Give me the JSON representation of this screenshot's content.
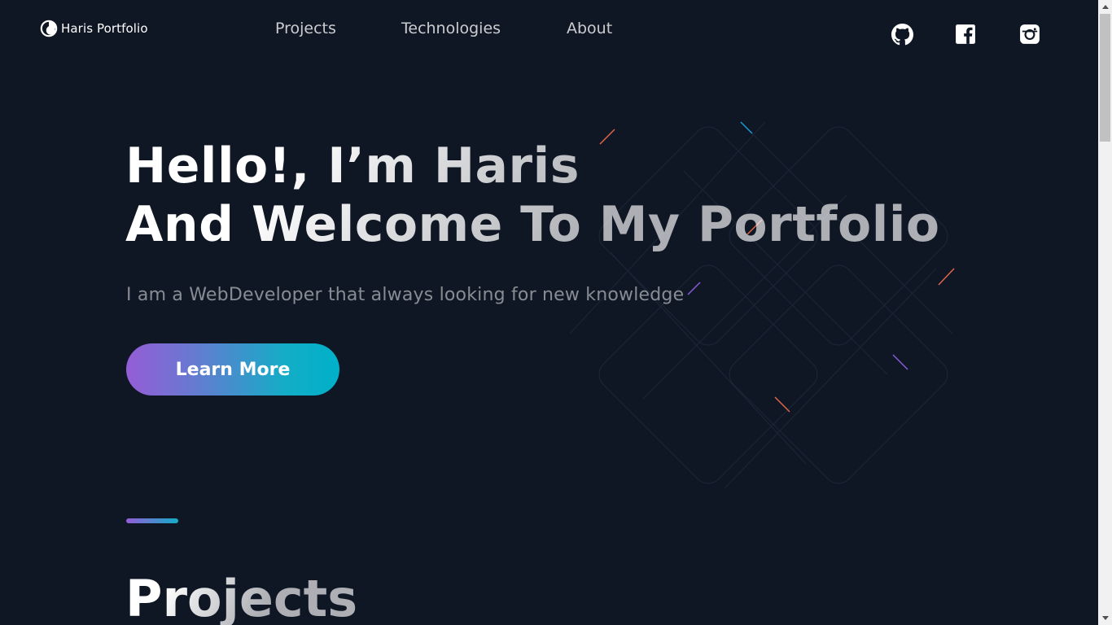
{
  "header": {
    "logo_text": "Haris Portfolio",
    "nav": [
      {
        "label": "Projects"
      },
      {
        "label": "Technologies"
      },
      {
        "label": "About"
      }
    ],
    "social": [
      {
        "icon": "github-icon"
      },
      {
        "icon": "facebook-icon"
      },
      {
        "icon": "instagram-icon"
      }
    ]
  },
  "hero": {
    "title_line1": "Hello!, I’m Haris",
    "title_line2": "And Welcome To My Portfolio",
    "subtitle": "I am a WebDeveloper that always looking for new knowledge",
    "button_label": "Learn More"
  },
  "projects_section": {
    "title": "Projects"
  },
  "colors": {
    "background": "#0f1624",
    "gradient_start": "#945dd6",
    "gradient_end": "#13adc7",
    "text_primary": "#ffffff"
  }
}
